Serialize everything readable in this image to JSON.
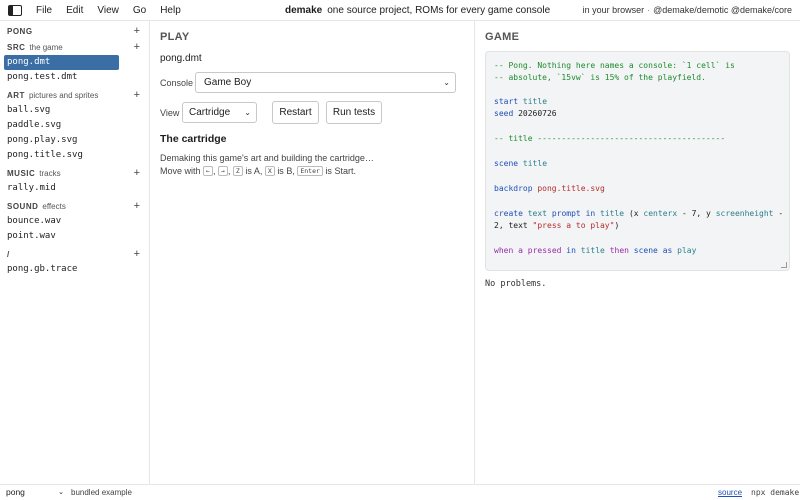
{
  "menubar": {
    "menus": [
      "File",
      "Edit",
      "View",
      "Go",
      "Help"
    ],
    "app_name": "demake",
    "app_tagline": "one source project, ROMs for every game console",
    "right_text": "in your browser",
    "right_sep": "·",
    "right_links": "@demake/demotic @demake/core"
  },
  "sidebar": {
    "project": {
      "name": "PONG",
      "plus": "+"
    },
    "src": {
      "name": "SRC",
      "sub": "the game",
      "plus": "+",
      "items": [
        "pong.dmt",
        "pong.test.dmt"
      ]
    },
    "art": {
      "name": "ART",
      "sub": "pictures and sprites",
      "plus": "+",
      "items": [
        "ball.svg",
        "paddle.svg",
        "pong.play.svg",
        "pong.title.svg"
      ]
    },
    "music": {
      "name": "MUSIC",
      "sub": "tracks",
      "plus": "+",
      "items": [
        "rally.mid"
      ]
    },
    "sound": {
      "name": "SOUND",
      "sub": "effects",
      "plus": "+",
      "items": [
        "bounce.wav",
        "point.wav"
      ]
    },
    "root": {
      "name": "/",
      "plus": "+",
      "items": [
        "pong.gb.trace"
      ]
    }
  },
  "play": {
    "heading": "PLAY",
    "filename": "pong.dmt",
    "console_label": "Console",
    "console_value": "Game Boy",
    "view_label": "View",
    "view_value": "Cartridge",
    "restart_label": "Restart",
    "run_tests_label": "Run tests",
    "cartridge_heading": "The cartridge",
    "cartridge_status": "Demaking this game's art and building the cartridge…",
    "controls": {
      "prefix": "Move with",
      "key_left": "←",
      "key_right": "→",
      "key_a": "Z",
      "is_a": "is A,",
      "key_b": "X",
      "is_b": "is B,",
      "key_start": "Enter",
      "is_start": "is Start."
    }
  },
  "game": {
    "heading": "GAME",
    "code": {
      "comment1": "-- Pong. Nothing here names a console: `1 cell` is",
      "comment2": "-- absolute, `15vw` is 15% of the playfield.",
      "start_kw": "start",
      "start_val": "title",
      "seed_kw": "seed",
      "seed_val": "20260726",
      "section": "-- title ---------------------------------------",
      "scene_kw": "scene",
      "scene_val": "title",
      "backdrop_kw": "backdrop",
      "backdrop_val": "pong.title.svg",
      "create_line_a": "create",
      "create_line_b": "text",
      "create_line_c": "prompt",
      "create_line_d": "in",
      "create_line_e": "title",
      "create_line_f": "(x",
      "create_line_g": "centerx",
      "create_line_h": "- 7, y",
      "create_line_i": "screenheight",
      "create_line_j": "-",
      "create_line2_a": "2, text",
      "create_line2_b": "\"press a to play\"",
      "create_line2_c": ")",
      "when_a": "when",
      "when_b": "a",
      "when_c": "pressed",
      "when_d": "in",
      "when_e": "title",
      "when_f": "then",
      "when_g": "scene",
      "when_h": "as",
      "when_i": "play"
    },
    "problems": "No problems."
  },
  "bottombar": {
    "project_value": "pong",
    "bundled_label": "bundled example",
    "source_link": "source",
    "npx_label": "npx demake"
  }
}
